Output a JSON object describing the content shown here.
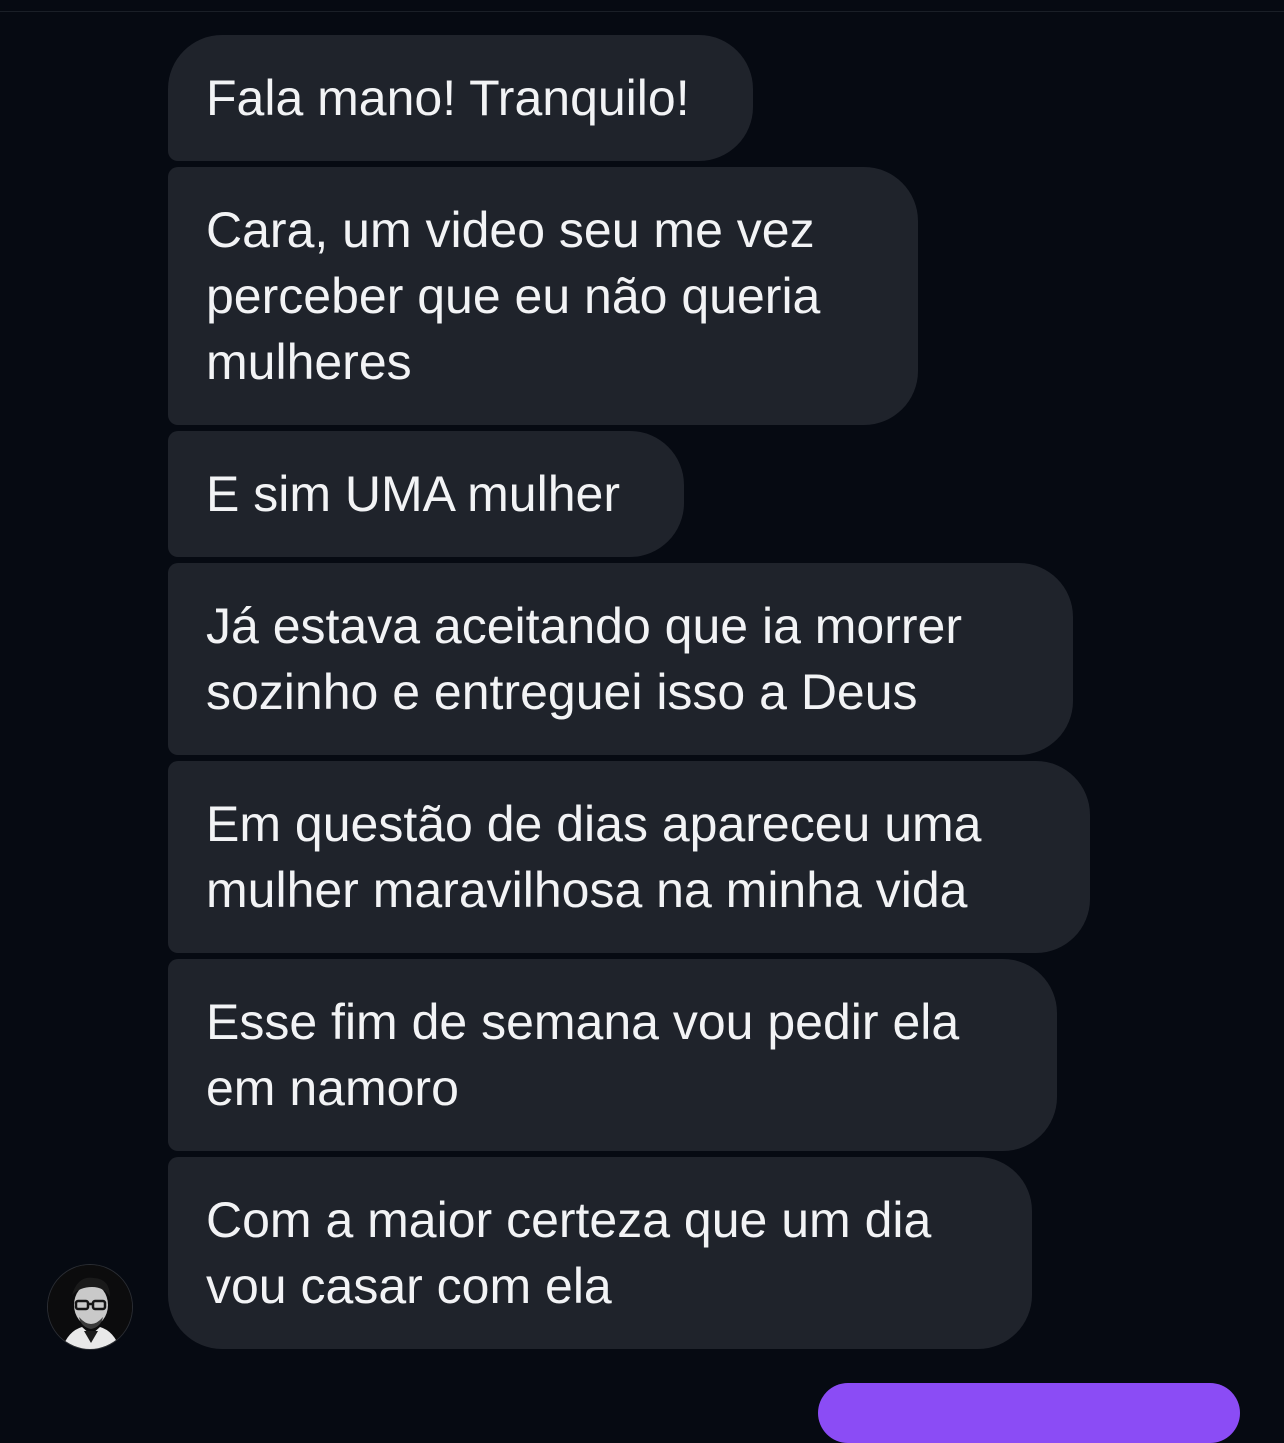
{
  "conversation": {
    "messages": [
      {
        "sender": "them",
        "text": "Fala mano! Tranquilo!"
      },
      {
        "sender": "them",
        "text": "Cara, um video seu me vez\nperceber que eu não queria\nmulheres"
      },
      {
        "sender": "them",
        "text": "E sim UMA mulher"
      },
      {
        "sender": "them",
        "text": "Já estava aceitando que ia morrer\nsozinho e entreguei isso a Deus"
      },
      {
        "sender": "them",
        "text": "Em questão de dias apareceu uma\nmulher maravilhosa na minha vida"
      },
      {
        "sender": "them",
        "text": "Esse fim de semana vou pedir ela\nem namoro"
      },
      {
        "sender": "them",
        "text": "Com a maior certeza que um dia\nvou casar com ela"
      }
    ],
    "sender_avatar_icon": "user-avatar",
    "outgoing_bubble_color": "#8b4cf5",
    "incoming_bubble_color": "#1f232b",
    "background_color": "#060a12"
  }
}
